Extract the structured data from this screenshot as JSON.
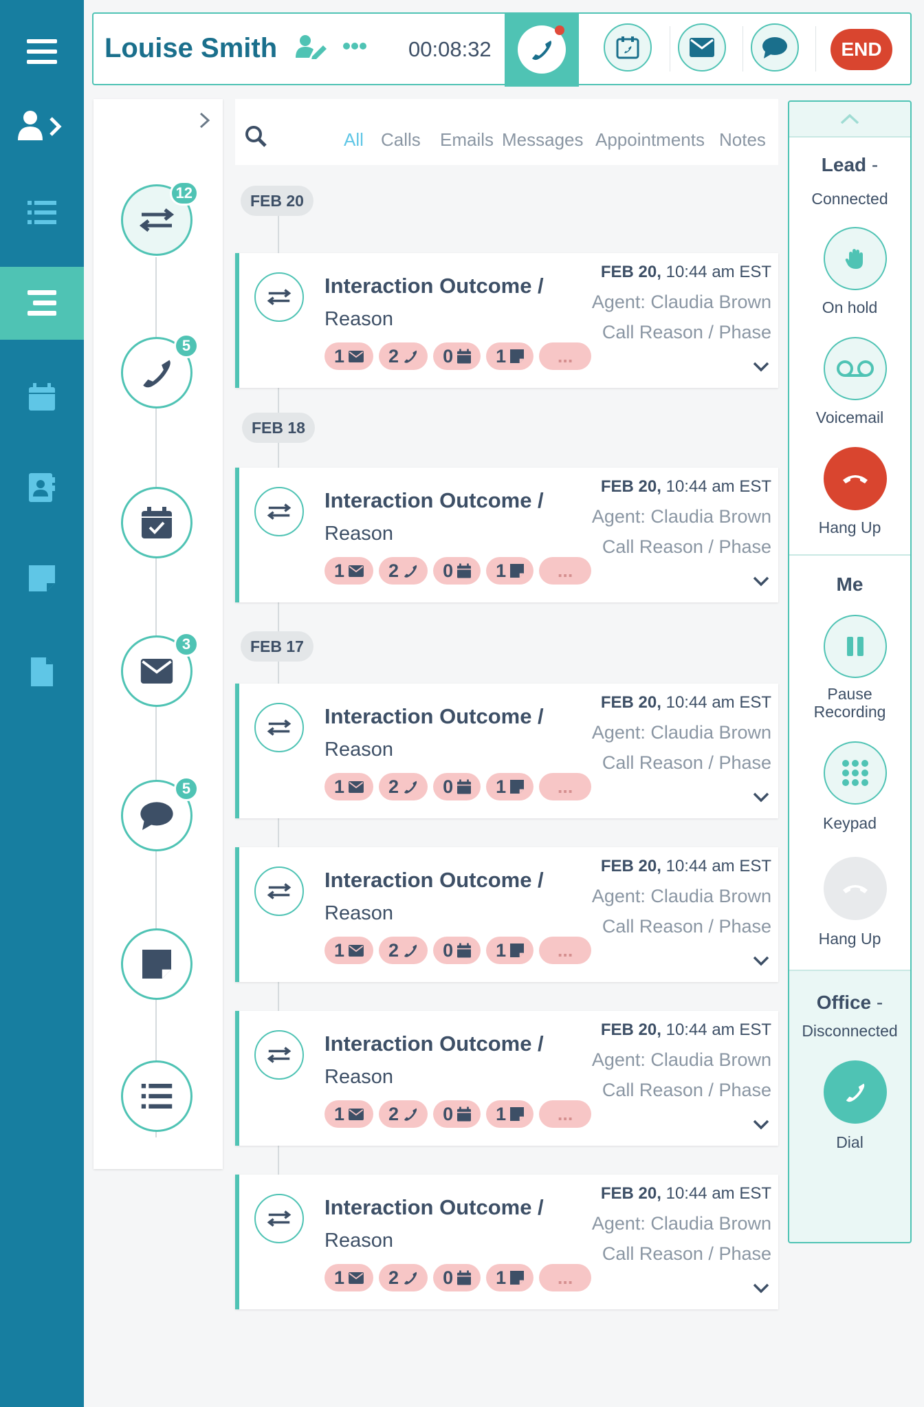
{
  "header": {
    "contact_name": "Louise Smith",
    "timer": "00:08:32",
    "end_label": "END"
  },
  "filters": {
    "tabs": [
      "All",
      "Calls",
      "Emails",
      "Messages",
      "Appointments",
      "Notes"
    ],
    "active": "All"
  },
  "timeline": {
    "badges": {
      "interactions": "12",
      "calls": "5",
      "emails": "3",
      "messages": "5"
    }
  },
  "dates": [
    "FEB 20",
    "FEB 18",
    "FEB 17"
  ],
  "card": {
    "title": "Interaction Outcome /",
    "reason": "Reason",
    "date_bold": "FEB 20,",
    "date_time": " 10:44 am EST",
    "agent": "Agent: Claudia Brown",
    "phase": "Call Reason / Phase",
    "chip_email": "1",
    "chip_call": "2",
    "chip_appt": "0",
    "chip_note": "1",
    "chip_more": "..."
  },
  "panel": {
    "lead_title": "Lead",
    "lead_dash": " -",
    "lead_status": "Connected",
    "hold_label": "On hold",
    "voicemail_label": "Voicemail",
    "hangup_label": "Hang Up",
    "me_title": "Me",
    "pause_label_1": "Pause",
    "pause_label_2": "Recording",
    "keypad_label": "Keypad",
    "hangup2_label": "Hang Up",
    "office_title": "Office",
    "office_dash": " -",
    "office_status": "Disconnected",
    "dial_label": "Dial"
  },
  "colors": {
    "nav_bg": "#177ea0",
    "accent": "#4fc3b4",
    "danger": "#d9452f",
    "chip": "#f7c6c6"
  }
}
